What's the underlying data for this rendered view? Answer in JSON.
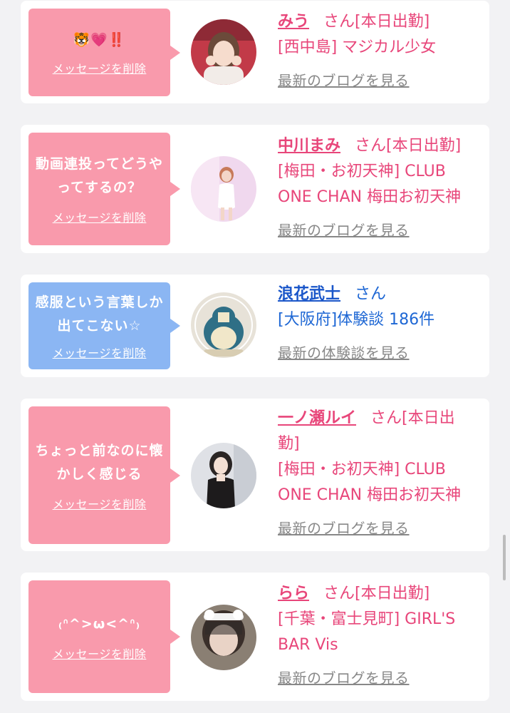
{
  "cards": [
    {
      "message": "🐯💗‼️",
      "delete_label": "メッセージを削除",
      "name": "みう",
      "suffix": "さん[本日出勤]",
      "details": [
        "[西中島] マジカル少女"
      ],
      "link": "最新のブログを見る"
    },
    {
      "message": "動画連投ってどうやってするの？",
      "delete_label": "メッセージを削除",
      "name": "中川まみ",
      "suffix": "さん[本日出勤]",
      "details": [
        "[梅田・お初天神] CLUB",
        "ONE CHAN 梅田お初天神"
      ],
      "link": "最新のブログを見る"
    },
    {
      "message": "感服という言葉しか出てこない☆",
      "delete_label": "メッセージを削除",
      "name": "浪花武士",
      "suffix": "さん",
      "details": [
        "[大阪府]体験談 186件"
      ],
      "link": "最新の体験談を見る"
    },
    {
      "message": "ちょっと前なのに懐かしく感じる",
      "delete_label": "メッセージを削除",
      "name": "一ノ瀬ルイ",
      "suffix": "さん[本日出",
      "details": [
        "勤]",
        "[梅田・お初天神] CLUB",
        "ONE CHAN 梅田お初天神"
      ],
      "link": "最新のブログを見る"
    },
    {
      "message": "₍ᐢ^>ω<^ᐢ₎",
      "delete_label": "メッセージを削除",
      "name": "らら",
      "suffix": "さん[本日出勤]",
      "details": [
        "[千葉・富士見町] GIRL'S",
        "BAR Vis"
      ],
      "link": "最新のブログを見る"
    }
  ],
  "colors": {
    "pink_bubble": "#f99aac",
    "blue_bubble": "#8bb6f3",
    "name_pink": "#e8467a",
    "name_blue": "#1a56c9"
  }
}
